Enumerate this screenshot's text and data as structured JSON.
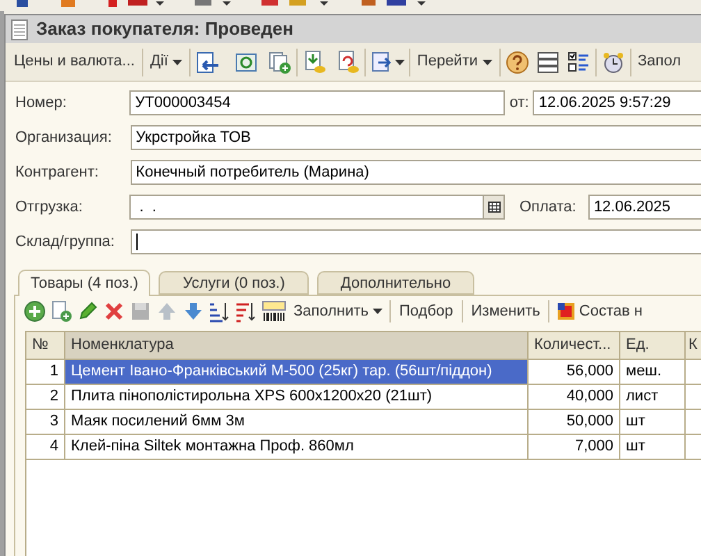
{
  "window": {
    "title": "Заказ покупателя: Проведен"
  },
  "toolbar": {
    "prices_button": "Цены и валюта...",
    "actions_menu": "Дії",
    "goto_menu": "Перейти",
    "fill_button": "Запол"
  },
  "form": {
    "number": {
      "label": "Номер:",
      "value": "УТ000003454"
    },
    "date": {
      "label": "от:",
      "value": "12.06.2025  9:57:29"
    },
    "organization": {
      "label": "Организация:",
      "value": "Укрстройка ТОВ"
    },
    "counterparty": {
      "label": "Контрагент:",
      "value": "Конечный потребитель (Марина)"
    },
    "shipment": {
      "label": "Отгрузка:",
      "value": " .  ."
    },
    "payment": {
      "label": "Оплата:",
      "value": "12.06.2025"
    },
    "warehouse": {
      "label": "Склад/группа:",
      "focused": true
    }
  },
  "tabs": [
    {
      "label": "Товары (4 поз.)",
      "selected": true
    },
    {
      "label": "Услуги (0 поз.)",
      "selected": false
    },
    {
      "label": "Дополнительно",
      "selected": false
    }
  ],
  "table_toolbar": {
    "fill_menu": "Заполнить",
    "pick_button": "Подбор",
    "change_button": "Изменить",
    "composition_button": "Состав н"
  },
  "table": {
    "columns": [
      "№",
      "Номенклатура",
      "Количест...",
      "Ед.",
      "К"
    ],
    "rows": [
      {
        "number": "1",
        "name": "Цемент Івано-Франківський М-500 (25кг) тар. (56шт/піддон)",
        "quantity": "56,000",
        "unit": "меш.",
        "selected": true
      },
      {
        "number": "2",
        "name": "Плита пінополістирольна XPS 600x1200x20 (21шт)",
        "quantity": "40,000",
        "unit": "лист",
        "selected": false
      },
      {
        "number": "3",
        "name": "Маяк посилений 6мм 3м",
        "quantity": "50,000",
        "unit": "шт",
        "selected": false
      },
      {
        "number": "4",
        "name": "Клей-піна Siltek монтажна Проф. 860мл",
        "quantity": "7,000",
        "unit": "шт",
        "selected": false
      }
    ]
  }
}
